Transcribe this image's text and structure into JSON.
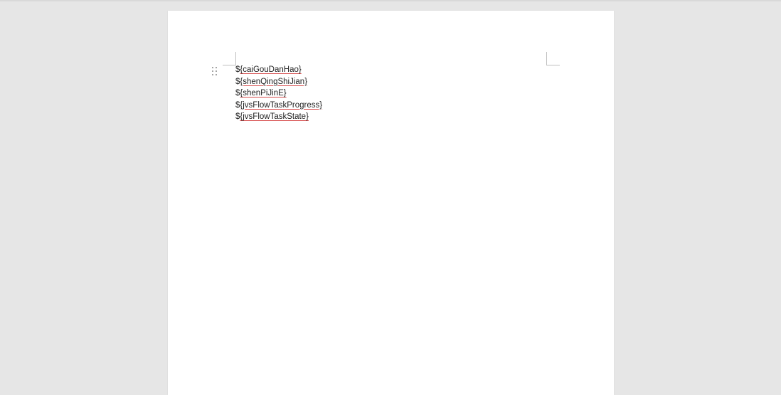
{
  "document": {
    "lines": [
      {
        "prefix": "$",
        "text": "{caiGouDanHao}"
      },
      {
        "prefix": "$",
        "text": "{shenQingShiJian}"
      },
      {
        "prefix": "$",
        "text": "{shenPiJinE}"
      },
      {
        "prefix": "$",
        "text": "{jvsFlowTaskProgress}"
      },
      {
        "prefix": "$",
        "text": "{jvsFlowTaskState}"
      }
    ]
  },
  "icons": {
    "drag_handle": "drag-handle-icon"
  },
  "colors": {
    "background": "#e6e6e6",
    "page": "#ffffff",
    "text": "#222222",
    "spell_underline": "#d64b4b"
  }
}
